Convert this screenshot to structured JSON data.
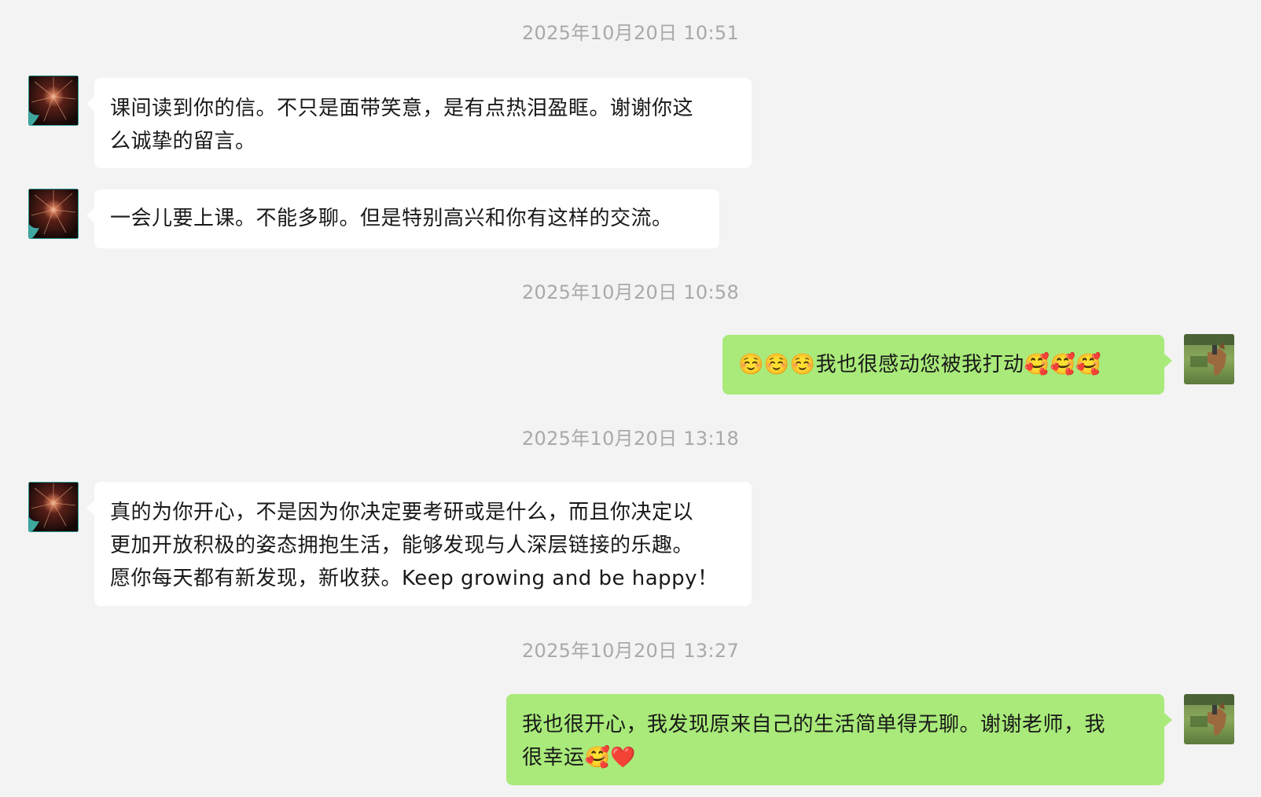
{
  "chat": {
    "timestamps": [
      "2025年10月20日 10:51",
      "2025年10月20日 10:58",
      "2025年10月20日 13:18",
      "2025年10月20日 13:27"
    ],
    "messages": [
      {
        "sender": "contact",
        "lines": [
          "课间读到你的信。不只是面带笑意，是有点热泪盈眶。谢谢你这",
          "么诚挚的留言。"
        ]
      },
      {
        "sender": "contact",
        "lines": [
          "一会儿要上课。不能多聊。但是特别高兴和你有这样的交流。"
        ]
      },
      {
        "sender": "me",
        "lines": [
          "☺️☺️☺️我也很感动您被我打动🥰🥰🥰"
        ]
      },
      {
        "sender": "contact",
        "lines": [
          "真的为你开心，不是因为你决定要考研或是什么，而且你决定以",
          "更加开放积极的姿态拥抱生活，能够发现与人深层链接的乐趣。",
          "愿你每天都有新发现，新收获。Keep growing and be happy！"
        ]
      },
      {
        "sender": "me",
        "lines": [
          "我也很开心，我发现原来自己的生活简单得无聊。谢谢老师，我",
          "很幸运🥰❤️"
        ]
      }
    ]
  },
  "colors": {
    "background": "#f3f3f3",
    "incoming_bubble": "#ffffff",
    "outgoing_bubble": "#a9ea7a",
    "timestamp_text": "#a9a9a9"
  }
}
